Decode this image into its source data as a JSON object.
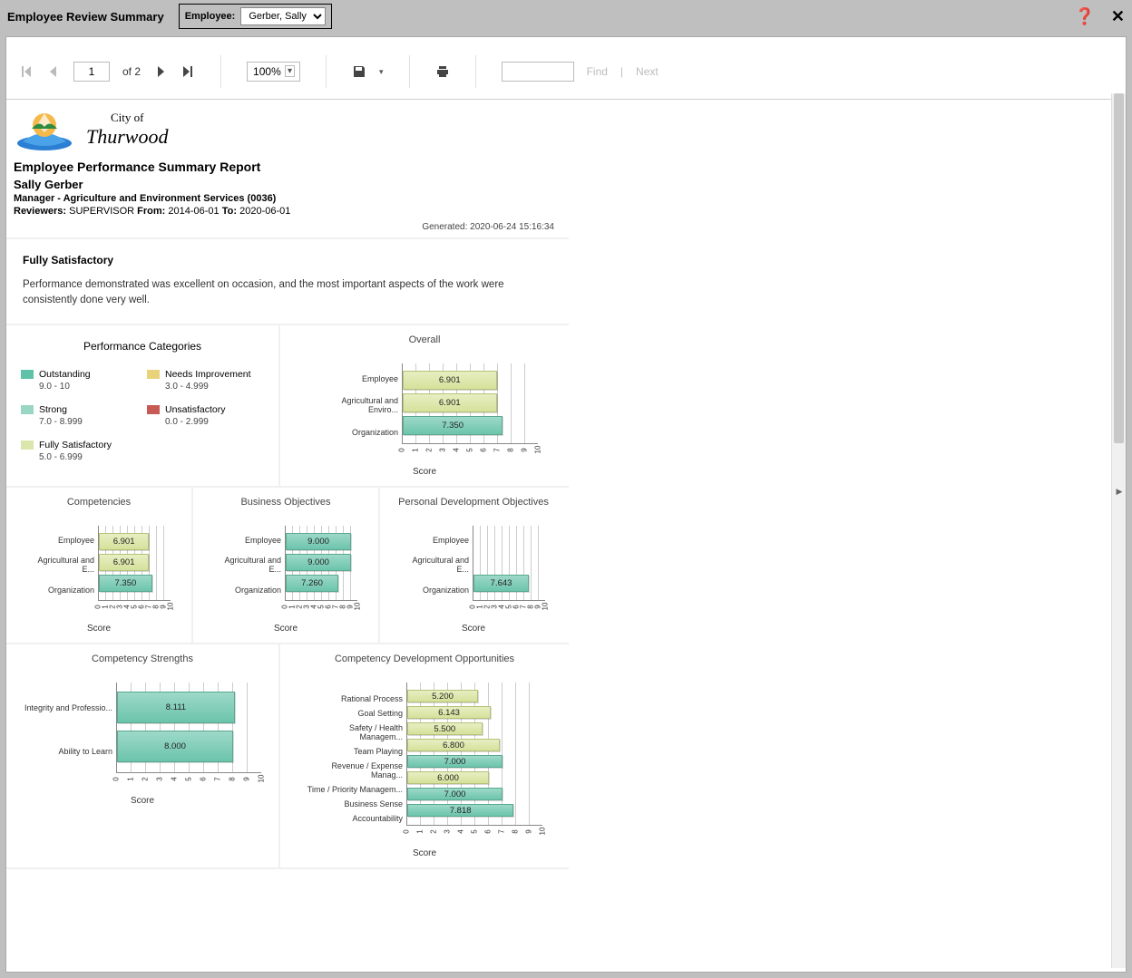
{
  "title": "Employee Review Summary",
  "employee_label": "Employee:",
  "employee_selected": "Gerber, Sally",
  "toolbar": {
    "page_current": "1",
    "page_sep": "of",
    "page_total": "2",
    "zoom": "100%",
    "find_placeholder": "Find",
    "next_label": "Next"
  },
  "logo": {
    "small": "City of",
    "big": "Thurwood"
  },
  "report": {
    "title": "Employee Performance Summary Report",
    "employee_name": "Sally Gerber",
    "position": "Manager - Agriculture and Environment Services (0036)",
    "reviewers_label": "Reviewers:",
    "reviewers": "SUPERVISOR",
    "from_label": "From:",
    "from": "2014-06-01",
    "to_label": "To:",
    "to": "2020-06-01",
    "generated": "Generated: 2020-06-24 15:16:34"
  },
  "summary": {
    "heading": "Fully Satisfactory",
    "body": "Performance demonstrated was excellent on occasion, and the most important aspects of the work were consistently done very well."
  },
  "legend": {
    "title": "Performance Categories",
    "items": [
      {
        "name": "Outstanding",
        "range": "9.0 - 10",
        "color": "#5ec1a8"
      },
      {
        "name": "Needs Improvement",
        "range": "3.0 - 4.999",
        "color": "#e9d37a"
      },
      {
        "name": "Strong",
        "range": "7.0 - 8.999",
        "color": "#9ad6c4"
      },
      {
        "name": "Unsatisfactory",
        "range": "0.0 - 2.999",
        "color": "#c85a56"
      },
      {
        "name": "Fully Satisfactory",
        "range": "5.0 - 6.999",
        "color": "#dbe6ad"
      }
    ]
  },
  "axis_label": "Score",
  "chart_data": [
    {
      "id": "overall",
      "title": "Overall",
      "type": "bar",
      "xlim": [
        0,
        10
      ],
      "series": [
        {
          "label": "Employee",
          "value": 6.901,
          "color": "green"
        },
        {
          "label": "Agricultural and Enviro...",
          "value": 6.901,
          "color": "green"
        },
        {
          "label": "Organization",
          "value": 7.35,
          "color": "teal"
        }
      ]
    },
    {
      "id": "competencies",
      "title": "Competencies",
      "type": "bar",
      "xlim": [
        0,
        10
      ],
      "series": [
        {
          "label": "Employee",
          "value": 6.901,
          "color": "green"
        },
        {
          "label": "Agricultural and E...",
          "value": 6.901,
          "color": "green"
        },
        {
          "label": "Organization",
          "value": 7.35,
          "color": "teal"
        }
      ]
    },
    {
      "id": "business",
      "title": "Business Objectives",
      "type": "bar",
      "xlim": [
        0,
        10
      ],
      "series": [
        {
          "label": "Employee",
          "value": 9.0,
          "color": "teal"
        },
        {
          "label": "Agricultural and E...",
          "value": 9.0,
          "color": "teal"
        },
        {
          "label": "Organization",
          "value": 7.26,
          "color": "teal"
        }
      ]
    },
    {
      "id": "personal",
      "title": "Personal Development Objectives",
      "type": "bar",
      "xlim": [
        0,
        10
      ],
      "series": [
        {
          "label": "Employee",
          "value": 0,
          "color": "none"
        },
        {
          "label": "Agricultural and E...",
          "value": 0,
          "color": "none"
        },
        {
          "label": "Organization",
          "value": 7.643,
          "color": "teal"
        }
      ]
    },
    {
      "id": "strengths",
      "title": "Competency Strengths",
      "type": "bar",
      "xlim": [
        0,
        10
      ],
      "series": [
        {
          "label": "Integrity and Professio...",
          "value": 8.111,
          "color": "teal"
        },
        {
          "label": "Ability to Learn",
          "value": 8.0,
          "color": "teal"
        }
      ]
    },
    {
      "id": "dev",
      "title": "Competency Development Opportunities",
      "type": "bar",
      "xlim": [
        0,
        10
      ],
      "series": [
        {
          "label": "Rational Process",
          "value": 5.2,
          "color": "green"
        },
        {
          "label": "Goal Setting",
          "value": 6.143,
          "color": "green"
        },
        {
          "label": "Safety / Health Managem...",
          "value": 5.5,
          "color": "green"
        },
        {
          "label": "Team Playing",
          "value": 6.8,
          "color": "green"
        },
        {
          "label": "Revenue / Expense Manag...",
          "value": 7.0,
          "color": "teal"
        },
        {
          "label": "Time / Priority Managem...",
          "value": 6.0,
          "color": "green"
        },
        {
          "label": "Business Sense",
          "value": 7.0,
          "color": "teal"
        },
        {
          "label": "Accountability",
          "value": 7.818,
          "color": "teal"
        }
      ]
    }
  ]
}
